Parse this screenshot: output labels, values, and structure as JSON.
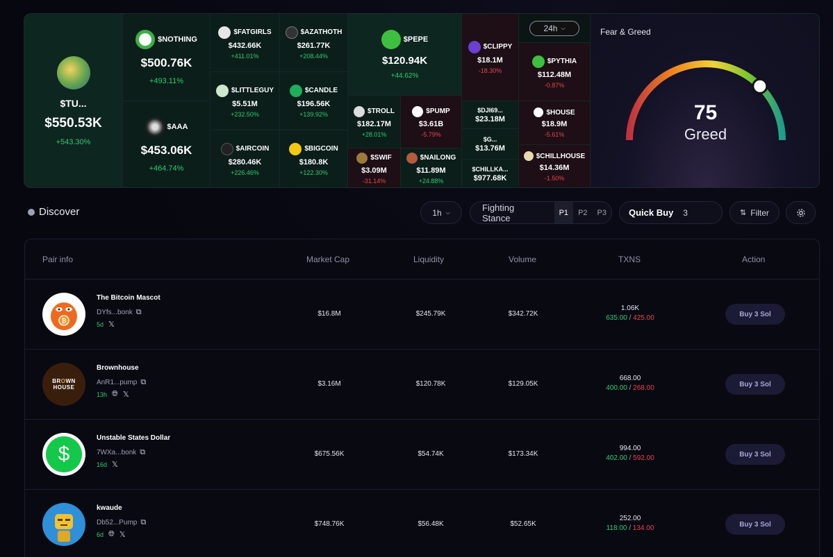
{
  "heatmap": {
    "timeframe": "24h",
    "tiles": [
      {
        "ticker": "$TU...",
        "mcap": "$550.53K",
        "change": "+543.30%",
        "dir": "up"
      },
      {
        "ticker": "$NOTHING",
        "mcap": "$500.76K",
        "change": "+493.11%",
        "dir": "up"
      },
      {
        "ticker": "$AAA",
        "mcap": "$453.06K",
        "change": "+464.74%",
        "dir": "up"
      },
      {
        "ticker": "$FATGIRLS",
        "mcap": "$432.66K",
        "change": "+411.01%",
        "dir": "up"
      },
      {
        "ticker": "$AZATHOTH",
        "mcap": "$261.77K",
        "change": "+208.44%",
        "dir": "up"
      },
      {
        "ticker": "$LITTLEGUY",
        "mcap": "$5.51M",
        "change": "+232.50%",
        "dir": "up"
      },
      {
        "ticker": "$CANDLE",
        "mcap": "$196.56K",
        "change": "+139.92%",
        "dir": "up"
      },
      {
        "ticker": "$AIRCOIN",
        "mcap": "$280.46K",
        "change": "+226.46%",
        "dir": "up"
      },
      {
        "ticker": "$BIGCOIN",
        "mcap": "$180.8K",
        "change": "+122.30%",
        "dir": "up"
      },
      {
        "ticker": "$PEPE",
        "mcap": "$120.94K",
        "change": "+44.62%",
        "dir": "up"
      },
      {
        "ticker": "$TROLL",
        "mcap": "$182.17M",
        "change": "+28.01%",
        "dir": "up"
      },
      {
        "ticker": "$PUMP",
        "mcap": "$3.61B",
        "change": "-5.79%",
        "dir": "dn"
      },
      {
        "ticker": "$SWIF",
        "mcap": "$3.09M",
        "change": "-31.14%",
        "dir": "dn"
      },
      {
        "ticker": "$NAILONG",
        "mcap": "$11.89M",
        "change": "+24.88%",
        "dir": "up"
      },
      {
        "ticker": "$CLIPPY",
        "mcap": "$18.1M",
        "change": "-18.30%",
        "dir": "dn"
      },
      {
        "ticker": "$DJI69...",
        "mcap": "$23.18M",
        "change": "",
        "dir": "up"
      },
      {
        "ticker": "$G...",
        "mcap": "$13.76M",
        "change": "",
        "dir": "up"
      },
      {
        "ticker": "$CHILLKA...",
        "mcap": "$977.68K",
        "change": "",
        "dir": "up"
      },
      {
        "ticker": "$PYTHIA",
        "mcap": "$112.48M",
        "change": "-0.87%",
        "dir": "dn"
      },
      {
        "ticker": "$HOUSE",
        "mcap": "$18.9M",
        "change": "-5.61%",
        "dir": "dn"
      },
      {
        "ticker": "$CHILLHOUSE",
        "mcap": "$14.36M",
        "change": "-1.50%",
        "dir": "dn"
      }
    ]
  },
  "fear_greed": {
    "title": "Fear & Greed",
    "value": "75",
    "label": "Greed",
    "level": 0.75
  },
  "discover": {
    "title": "Discover",
    "interval": "1h",
    "stance_label": "Fighting Stance",
    "presets": [
      "P1",
      "P2",
      "P3"
    ],
    "quick_buy_label": "Quick Buy",
    "quick_buy_value": "3",
    "filter_label": "Filter"
  },
  "table": {
    "headers": [
      "Pair info",
      "Market Cap",
      "Liquidity",
      "Volume",
      "TXNS",
      "Action"
    ],
    "rows": [
      {
        "name": "The Bitcoin Mascot",
        "address": "DYfs...bonk",
        "age": "5d",
        "mcap": "$16.8M",
        "liquidity": "$245.79K",
        "volume": "$342.72K",
        "txns": "1.06K",
        "buys": "635.00",
        "sells": "425.00",
        "action": "Buy 3 Sol",
        "web": false
      },
      {
        "name": "Brownhouse",
        "address": "AnR1...pump",
        "age": "13h",
        "mcap": "$3.16M",
        "liquidity": "$120.78K",
        "volume": "$129.05K",
        "txns": "668.00",
        "buys": "400.00",
        "sells": "268.00",
        "action": "Buy 3 Sol",
        "web": true
      },
      {
        "name": "Unstable States Dollar",
        "address": "7WXa...bonk",
        "age": "16d",
        "mcap": "$675.56K",
        "liquidity": "$54.74K",
        "volume": "$173.34K",
        "txns": "994.00",
        "buys": "402.00",
        "sells": "592.00",
        "action": "Buy 3 Sol",
        "web": false
      },
      {
        "name": "kwaude",
        "address": "Db52...Pump",
        "age": "6d",
        "mcap": "$748.76K",
        "liquidity": "$56.48K",
        "volume": "$52.65K",
        "txns": "252.00",
        "buys": "118.00",
        "sells": "134.00",
        "action": "Buy 3 Sol",
        "web": true
      }
    ],
    "logo_text": {
      "brownhouse_top": "BR",
      "brownhouse_o": "O",
      "brownhouse_rest": "WN",
      "brownhouse_bottom": "HOUSE",
      "usd_symbol": "$"
    }
  },
  "colors": {
    "up": "#2ecc71",
    "down": "#e8454e",
    "accent": "#1c1b35"
  }
}
